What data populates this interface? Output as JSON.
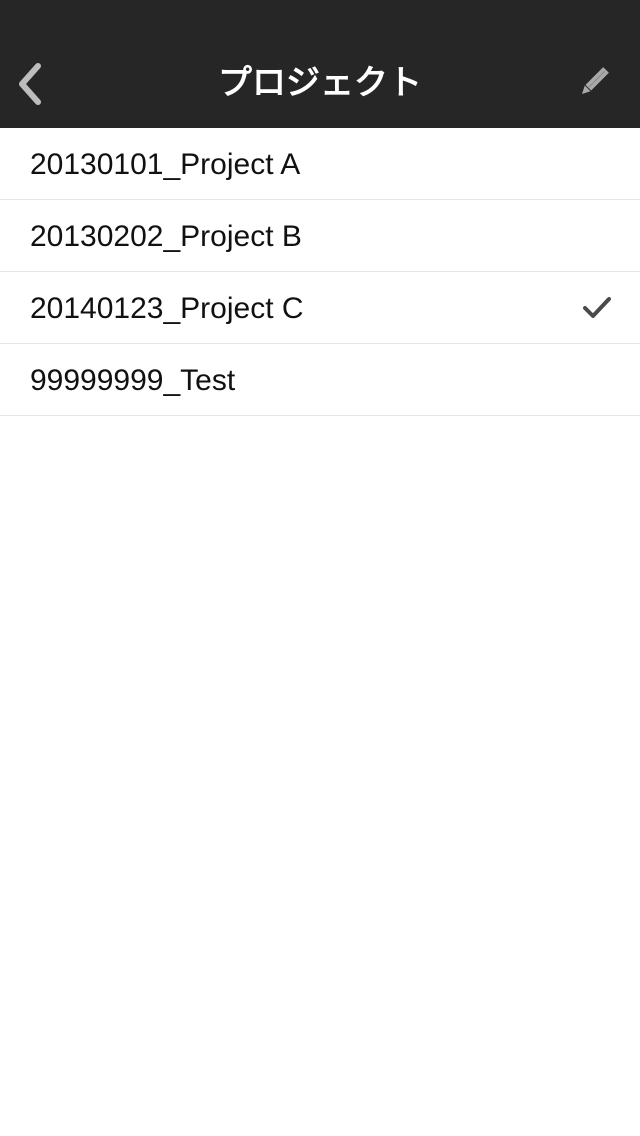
{
  "nav": {
    "title": "プロジェクト",
    "back_icon": "chevron-left-icon",
    "edit_icon": "pencil-icon",
    "background": "#262626"
  },
  "projects": [
    {
      "label": "20130101_Project A",
      "selected": false
    },
    {
      "label": "20130202_Project B",
      "selected": false
    },
    {
      "label": "20140123_Project C",
      "selected": true
    },
    {
      "label": "99999999_Test",
      "selected": false
    }
  ],
  "check_icon": "checkmark-icon"
}
